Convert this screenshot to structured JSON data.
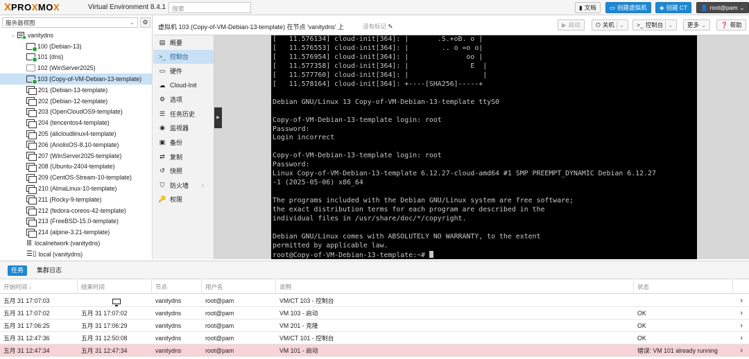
{
  "topbar": {
    "logo_x": "X",
    "logo_pro": "PRO",
    "logo_x2": "X",
    "logo_mo": "MO",
    "logo_x3": "X",
    "product": "Virtual Environment 8.4.1",
    "search_placeholder": "搜索",
    "docs": "文档",
    "create_vm": "创建虚拟机",
    "create_ct": "创建 CT",
    "user": "root@pam"
  },
  "left": {
    "view_label": "服务器视图",
    "node": "vanitydns",
    "items": [
      {
        "label": "100 (Debian-13)",
        "kind": "vm-run"
      },
      {
        "label": "101 (dns)",
        "kind": "vm-run"
      },
      {
        "label": "102 (WinServer2025)",
        "kind": "vm-off"
      },
      {
        "label": "103 (Copy-of-VM-Debian-13-template)",
        "kind": "vm-run"
      },
      {
        "label": "201 (Debian-13-template)",
        "kind": "tpl"
      },
      {
        "label": "202 (Debian-12-template)",
        "kind": "tpl"
      },
      {
        "label": "203 (OpenCloudOS9-template)",
        "kind": "tpl"
      },
      {
        "label": "204 (tencentos4-template)",
        "kind": "tpl"
      },
      {
        "label": "205 (alicloudlinux4-template)",
        "kind": "tpl"
      },
      {
        "label": "206 (AnolisOS-8.10-template)",
        "kind": "tpl"
      },
      {
        "label": "207 (WinServer2025-template)",
        "kind": "tpl"
      },
      {
        "label": "208 (Ubuntu-2404-template)",
        "kind": "tpl"
      },
      {
        "label": "209 (CentOS-Stream-10-template)",
        "kind": "tpl"
      },
      {
        "label": "210 (AlmaLinux-10-template)",
        "kind": "tpl"
      },
      {
        "label": "211 (Rocky-9-template)",
        "kind": "tpl"
      },
      {
        "label": "212 (fedora-coreos-42-template)",
        "kind": "tpl"
      },
      {
        "label": "213 (FreeBSD-15.0-template)",
        "kind": "tpl"
      },
      {
        "label": "214 (alpine-3.21-template)",
        "kind": "tpl"
      },
      {
        "label": "localnetwork (vanitydns)",
        "kind": "net"
      },
      {
        "label": "local (vanitydns)",
        "kind": "storage"
      }
    ]
  },
  "header": {
    "title": "虚拟机 103 (Copy-of-VM-Debian-13-template) 在节点 'vanitydns' 上",
    "no_tags": "没有标记",
    "start": "启动",
    "shutdown": "关机",
    "console": "控制台",
    "more": "更多",
    "help": "帮助"
  },
  "menu": [
    {
      "icon": "▤",
      "label": "概要",
      "name": "summary"
    },
    {
      "icon": ">_",
      "label": "控制台",
      "name": "console"
    },
    {
      "icon": "▭",
      "label": "硬件",
      "name": "hardware"
    },
    {
      "icon": "☁",
      "label": "Cloud-Init",
      "name": "cloud-init"
    },
    {
      "icon": "⚙",
      "label": "选项",
      "name": "options"
    },
    {
      "icon": "☰",
      "label": "任务历史",
      "name": "task-history"
    },
    {
      "icon": "◉",
      "label": "监视器",
      "name": "monitor"
    },
    {
      "icon": "▣",
      "label": "备份",
      "name": "backup"
    },
    {
      "icon": "⇄",
      "label": "复制",
      "name": "replication"
    },
    {
      "icon": "↺",
      "label": "快照",
      "name": "snapshots"
    },
    {
      "icon": "⛉",
      "label": "防火墙",
      "name": "firewall"
    },
    {
      "icon": "🔑",
      "label": "权限",
      "name": "permissions"
    }
  ],
  "terminal": {
    "text": "[   11.576134] cloud-init[364]: |       .S.+oB. o |\n[   11.576553] cloud-init[364]: |        .. o =o o|\n[   11.576954] cloud-init[364]: |              oo |\n[   11.577358] cloud-init[364]: |               E  |\n[   11.577760] cloud-init[364]: |                  |\n[   11.578164] cloud-init[364]: +----[SHA256]-----+\n\nDebian GNU/Linux 13 Copy-of-VM-Debian-13-template ttyS0\n\nCopy-of-VM-Debian-13-template login: root\nPassword:\nLogin incorrect\n\nCopy-of-VM-Debian-13-template login: root\nPassword:\nLinux Copy-of-VM-Debian-13-template 6.12.27-cloud-amd64 #1 SMP PREEMPT_DYNAMIC Debian 6.12.27\n-1 (2025-05-06) x86_64\n\nThe programs included with the Debian GNU/Linux system are free software;\nthe exact distribution terms for each program are described in the\nindividual files in /usr/share/doc/*/copyright.\n\nDebian GNU/Linux comes with ABSOLUTELY NO WARRANTY, to the extent\npermitted by applicable law.\nroot@Copy-of-VM-Debian-13-template:~# "
  },
  "tasks": {
    "tab_tasks": "任务",
    "tab_cluster_log": "集群日志",
    "columns": {
      "start": "开始时间 ↓",
      "end": "结束时间",
      "node": "节点",
      "user": "用户名",
      "desc": "说明",
      "status": "状态"
    },
    "rows": [
      {
        "start": "五月 31 17:07:03",
        "end": "",
        "node": "vanitydns",
        "user": "root@pam",
        "desc": "VM/CT 103 - 控制台",
        "status": "",
        "error": false,
        "running": true
      },
      {
        "start": "五月 31 17:07:02",
        "end": "五月 31 17:07:02",
        "node": "vanitydns",
        "user": "root@pam",
        "desc": "VM 103 - 启动",
        "status": "OK",
        "error": false,
        "running": false
      },
      {
        "start": "五月 31 17:06:25",
        "end": "五月 31 17:06:29",
        "node": "vanitydns",
        "user": "root@pam",
        "desc": "VM 201 - 克隆",
        "status": "OK",
        "error": false,
        "running": false
      },
      {
        "start": "五月 31 12:47:36",
        "end": "五月 31 12:50:08",
        "node": "vanitydns",
        "user": "root@pam",
        "desc": "VM/CT 101 - 控制台",
        "status": "OK",
        "error": false,
        "running": false
      },
      {
        "start": "五月 31 12:47:34",
        "end": "五月 31 12:47:34",
        "node": "vanitydns",
        "user": "root@pam",
        "desc": "VM 101 - 启动",
        "status": "错误: VM 101 already running",
        "error": true,
        "running": false
      }
    ]
  }
}
